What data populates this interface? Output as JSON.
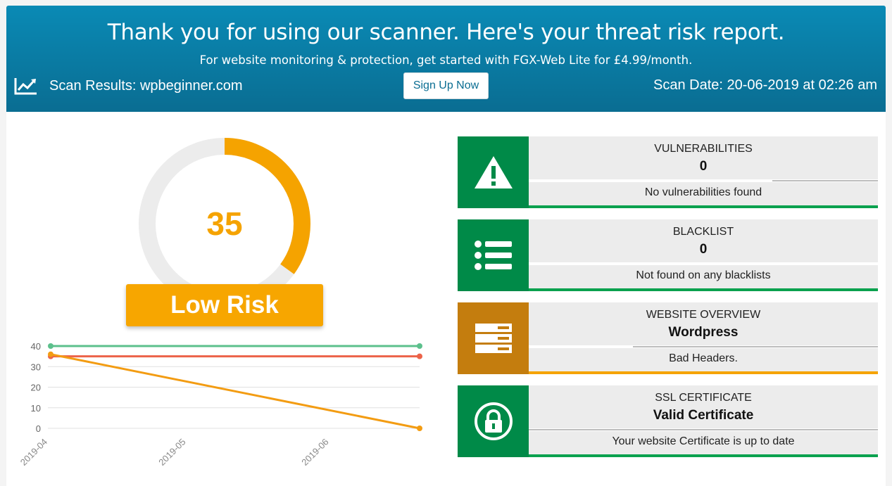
{
  "header": {
    "title": "Thank you for using our scanner. Here's your threat risk report.",
    "subtitle": "For website monitoring & protection, get started with FGX-Web Lite for £4.99/month.",
    "scan_results": "Scan Results: wpbeginner.com",
    "signup_label": "Sign Up Now",
    "scan_date": "Scan Date: 20-06-2019 at 02:26 am"
  },
  "gauge": {
    "score": "35",
    "max": 100,
    "color": "#f5a300",
    "risk_label": "Low Risk"
  },
  "chart_data": {
    "type": "line",
    "x": [
      "2019-04",
      "2019-05",
      "2019-06",
      "2019-06-20"
    ],
    "x_tick_labels": [
      "2019-04",
      "2019-05",
      "2019-06"
    ],
    "ylim": [
      0,
      40
    ],
    "yticks": [
      0,
      10,
      20,
      30,
      40
    ],
    "grid": true,
    "series": [
      {
        "color": "#5cc08c",
        "points": [
          [
            "2019-04",
            40
          ],
          [
            "2019-06-20",
            40
          ]
        ]
      },
      {
        "color": "#ec6349",
        "points": [
          [
            "2019-04",
            35
          ],
          [
            "2019-06-20",
            35
          ]
        ]
      },
      {
        "color": "#f39c12",
        "points": [
          [
            "2019-04",
            36
          ],
          [
            "2019-06-20",
            0
          ]
        ]
      }
    ]
  },
  "cards": [
    {
      "icon": "warning-icon",
      "label": "VULNERABILITIES",
      "value": "0",
      "desc": "No vulnerabilities found",
      "status": "green"
    },
    {
      "icon": "list-icon",
      "label": "BLACKLIST",
      "value": "0",
      "desc": "Not found on any blacklists",
      "status": "green"
    },
    {
      "icon": "server-icon",
      "label": "WEBSITE OVERVIEW",
      "value": "Wordpress",
      "desc": "Bad Headers.",
      "status": "orange"
    },
    {
      "icon": "lock-icon",
      "label": "SSL CERTIFICATE",
      "value": "Valid Certificate",
      "desc": "Your website Certificate is up to date",
      "status": "green"
    }
  ]
}
